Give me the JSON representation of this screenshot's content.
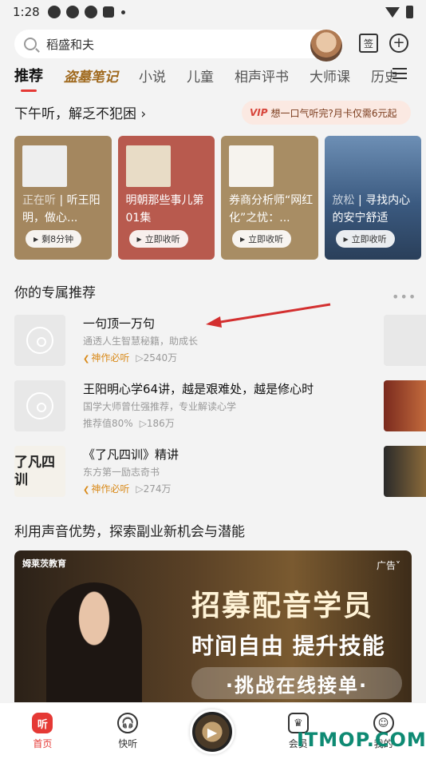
{
  "status": {
    "time": "1:28"
  },
  "search": {
    "text": "稻盛和夫"
  },
  "top": {
    "sign_label": "签"
  },
  "tabs": [
    "推荐",
    "盗墓笔记",
    "小说",
    "儿童",
    "相声评书",
    "大师课",
    "历史"
  ],
  "section1": {
    "title": "下午听，解乏不犯困 ›",
    "vip_tag": "VIP",
    "vip_text": "想一口气听完?月卡仅需6元起"
  },
  "cards": [
    {
      "status": "正在听",
      "title": "听王阳明，做心...",
      "button": "剩8分钟",
      "bg": "#a4875f"
    },
    {
      "status": "",
      "title": "明朝那些事儿第01集",
      "button": "立即收听",
      "bg": "#b85a4e"
    },
    {
      "status": "",
      "title": "券商分析师“网红化”之忧：...",
      "button": "立即收听",
      "bg": "#a88d64"
    },
    {
      "status": "放松",
      "title": "寻找内心的安宁舒适",
      "button": "立即收听",
      "bg": "#4b6f97"
    }
  ],
  "recs": {
    "title": "你的专属推荐",
    "items": [
      {
        "title": "一句顶一万句",
        "sub": "通透人生智慧秘籍，助成长",
        "badge": "神作必听",
        "plays": "▷2540万"
      },
      {
        "title": "王阳明心学64讲，越是艰难处，越是修心时",
        "sub": "国学大师曾仕强推荐，专业解读心学",
        "badge": "推荐值80%",
        "plays": "▷186万"
      },
      {
        "title": "《了凡四训》精讲",
        "sub": "东方第一励志奇书",
        "badge": "神作必听",
        "plays": "▷274万",
        "cover": "了凡四训"
      }
    ]
  },
  "ad": {
    "section_title": "利用声音优势，探索副业新机会与潜能",
    "brand": "姆莱茨教育",
    "tag": "广告",
    "headline": "招募配音学员",
    "line2": "时间自由 提升技能",
    "line3": "·挑战在线接单·"
  },
  "nav": [
    {
      "label": "首页",
      "icon": "听"
    },
    {
      "label": "快听",
      "icon": "🎧"
    },
    {
      "label": "",
      "icon": ""
    },
    {
      "label": "会员",
      "icon": "♛"
    },
    {
      "label": "我的",
      "icon": "☺"
    }
  ],
  "watermark": "ITMOP.COM"
}
